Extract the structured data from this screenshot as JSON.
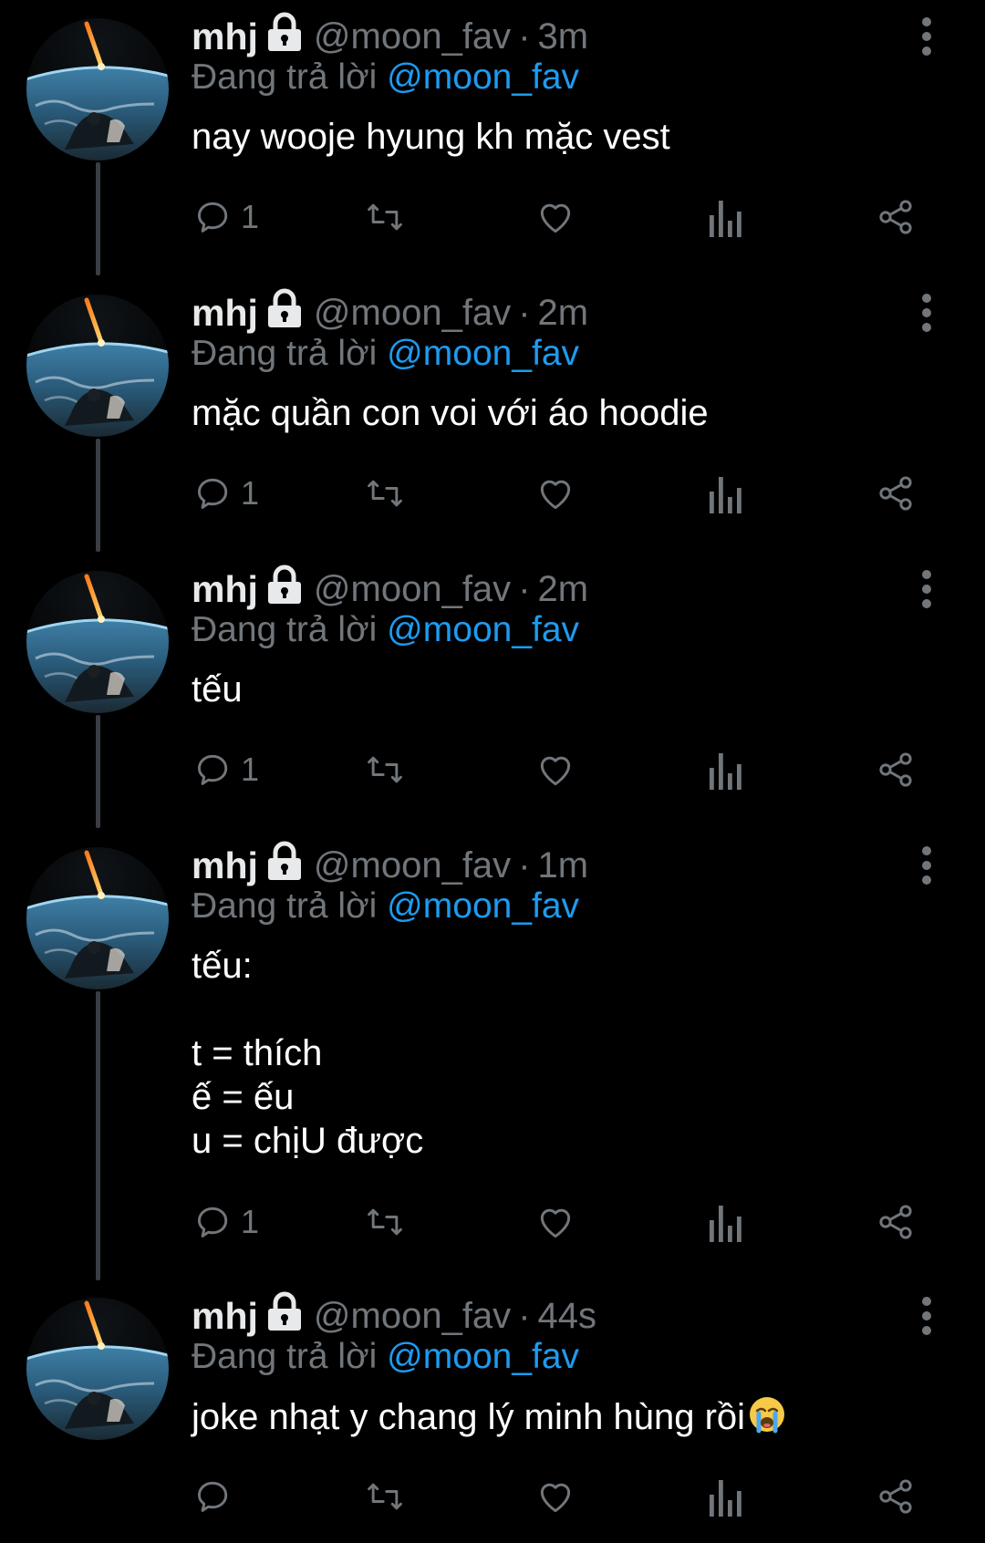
{
  "colors": {
    "background": "#000000",
    "text": "#e7e9ea",
    "muted": "#71767b",
    "accent": "#1d9bf0",
    "thread_line": "#3a3d42"
  },
  "icons": {
    "protected": "lock-icon",
    "more": "three-dots-vertical-icon",
    "reply": "speech-bubble-icon",
    "retweet": "retweet-icon",
    "like": "heart-icon",
    "views": "bar-chart-icon",
    "share": "share-icon"
  },
  "tweets": [
    {
      "display_name": "mhj",
      "handle": "@moon_fav",
      "separator": "·",
      "time": "3m",
      "reply_label": "Đang trả lời",
      "reply_handle": "@moon_fav",
      "text": "nay wooje hyung kh mặc vest",
      "reply_count": "1"
    },
    {
      "display_name": "mhj",
      "handle": "@moon_fav",
      "separator": "·",
      "time": "2m",
      "reply_label": "Đang trả lời",
      "reply_handle": "@moon_fav",
      "text": "mặc quần con voi với áo hoodie",
      "reply_count": "1"
    },
    {
      "display_name": "mhj",
      "handle": "@moon_fav",
      "separator": "·",
      "time": "2m",
      "reply_label": "Đang trả lời",
      "reply_handle": "@moon_fav",
      "text": "tếu",
      "reply_count": "1"
    },
    {
      "display_name": "mhj",
      "handle": "@moon_fav",
      "separator": "·",
      "time": "1m",
      "reply_label": "Đang trả lời",
      "reply_handle": "@moon_fav",
      "text": "tếu:\n\nt = thích\nế = ếu\nu = chịU được",
      "reply_count": "1"
    },
    {
      "display_name": "mhj",
      "handle": "@moon_fav",
      "separator": "·",
      "time": "44s",
      "reply_label": "Đang trả lời",
      "reply_handle": "@moon_fav",
      "text": "joke nhạt y chang lý minh hùng rồi",
      "text_emoji": "loudly-crying-face-emoji",
      "reply_count": ""
    }
  ]
}
